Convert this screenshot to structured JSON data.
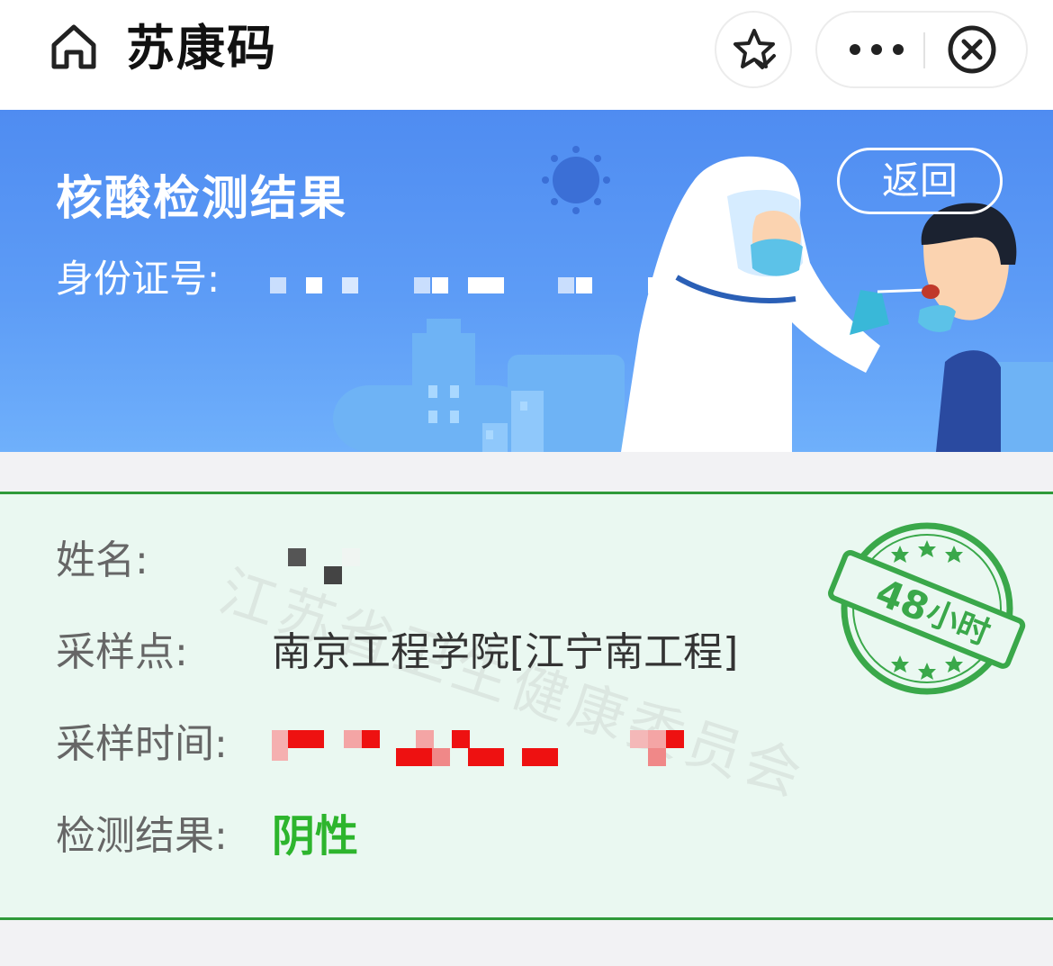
{
  "header": {
    "title": "苏康码",
    "icons": {
      "home": "home-icon",
      "favorite": "star-check-icon",
      "more": "more-dots-icon",
      "close": "close-circle-icon"
    }
  },
  "banner": {
    "title": "核酸检测结果",
    "id_label": "身份证号:",
    "back_label": "返回"
  },
  "result": {
    "name_label": "姓名:",
    "site_label": "采样点:",
    "site_value": "南京工程学院[江宁南工程]",
    "time_label": "采样时间:",
    "result_label": "检测结果:",
    "result_value": "阴性",
    "watermark_text": "江苏省卫生健康委员会",
    "stamp_number": "48",
    "stamp_unit": "小时"
  },
  "colors": {
    "banner_blue": "#4f8cf1",
    "card_bg": "#eaf8f1",
    "card_border": "#2f9a3a",
    "negative_green": "#2db52d",
    "stamp_green": "#3aa84a"
  }
}
